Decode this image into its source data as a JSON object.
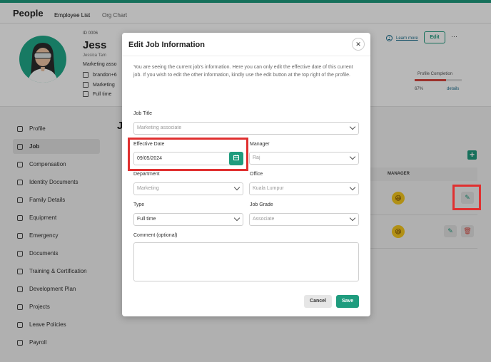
{
  "topnav": {
    "app_title": "People",
    "tabs": [
      "Employee List",
      "Org Chart"
    ]
  },
  "employee": {
    "id": "ID 0006",
    "name": "Jess",
    "full_name": "Jessica Tam",
    "role": "Marketing asso",
    "email": "brandon+6",
    "department": "Marketing",
    "type": "Full time"
  },
  "header_actions": {
    "learn_more": "Learn more",
    "edit": "Edit",
    "more": "···"
  },
  "profile_completion": {
    "label": "Profile Completion",
    "value": 0.67,
    "percent_text": "67%",
    "details": "details"
  },
  "sidebar": {
    "items": [
      {
        "label": "Profile",
        "icon": "person-icon"
      },
      {
        "label": "Job",
        "icon": "briefcase-icon"
      },
      {
        "label": "Compensation",
        "icon": "money-icon"
      },
      {
        "label": "Identity Documents",
        "icon": "id-card-icon"
      },
      {
        "label": "Family Details",
        "icon": "family-icon"
      },
      {
        "label": "Equipment",
        "icon": "laptop-icon"
      },
      {
        "label": "Emergency",
        "icon": "phone-icon"
      },
      {
        "label": "Documents",
        "icon": "document-icon"
      },
      {
        "label": "Training & Certification",
        "icon": "certificate-icon"
      },
      {
        "label": "Development Plan",
        "icon": "chart-icon"
      },
      {
        "label": "Projects",
        "icon": "projects-icon"
      },
      {
        "label": "Leave Policies",
        "icon": "hourglass-icon"
      },
      {
        "label": "Payroll",
        "icon": "payroll-icon"
      }
    ],
    "active": "Job"
  },
  "content": {
    "heading": "J",
    "plus": "+",
    "table_header_manager": "MANAGER"
  },
  "modal": {
    "title": "Edit Job Information",
    "close": "✕",
    "info": "You are seeing the current job's information. Here you can only edit the effective date of this current job. If you wish to edit the other information, kindly use the edit button at the top right of the profile.",
    "job_title_label": "Job Title",
    "job_title_value": "Marketing associate",
    "effective_date_label": "Effective Date",
    "effective_date_value": "09/05/2024",
    "manager_label": "Manager",
    "manager_value": "Raj",
    "department_label": "Department",
    "department_value": "Marketing",
    "office_label": "Office",
    "office_value": "Kuala Lumpur",
    "type_label": "Type",
    "type_value": "Full time",
    "job_grade_label": "Job Grade",
    "job_grade_value": "Associate",
    "comment_label": "Comment (optional)",
    "cancel": "Cancel",
    "save": "Save"
  },
  "colors": {
    "accent": "#1f9c7e",
    "highlight": "#e03030",
    "danger": "#d9463e"
  }
}
